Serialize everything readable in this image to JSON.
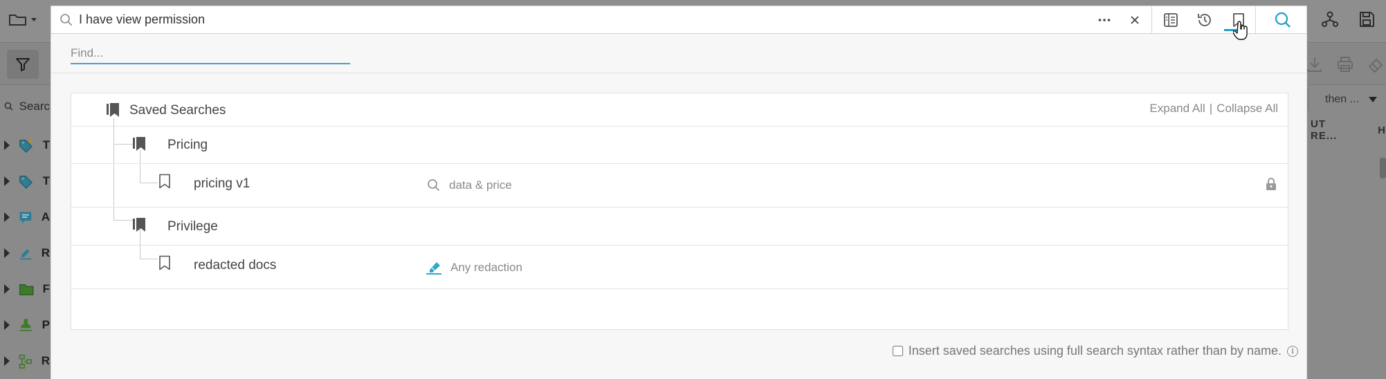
{
  "search": {
    "query": "I have view permission",
    "more_label": "···",
    "clear_label": "×"
  },
  "find": {
    "placeholder": "Find..."
  },
  "saved_searches": {
    "root_label": "Saved Searches",
    "expand_all": "Expand All",
    "separator": "|",
    "collapse_all": "Collapse All",
    "groups": [
      {
        "label": "Pricing",
        "items": [
          {
            "label": "pricing v1",
            "query": "data & price",
            "query_icon": "search-icon",
            "locked": true
          }
        ]
      },
      {
        "label": "Privilege",
        "items": [
          {
            "label": "redacted docs",
            "query": "Any redaction",
            "query_icon": "highlighter-icon",
            "locked": false
          }
        ]
      }
    ]
  },
  "insert_option": {
    "label": "Insert saved searches using full search syntax rather than by name.",
    "checked": false
  },
  "background": {
    "search_placeholder": "Searc",
    "sort_label": "then ...",
    "column_header_1": "UT RE...",
    "column_header_2": "H",
    "rows": [
      {
        "letter": "T",
        "icon": "tag-sparkle-icon"
      },
      {
        "letter": "T",
        "icon": "tag-icon"
      },
      {
        "letter": "A",
        "icon": "annotation-icon"
      },
      {
        "letter": "R",
        "icon": "redaction-icon"
      },
      {
        "letter": "F",
        "icon": "folder-icon"
      },
      {
        "letter": "P",
        "icon": "stamp-icon"
      },
      {
        "letter": "R",
        "icon": "workflow-icon"
      }
    ]
  },
  "colors": {
    "accent": "#1e9ecb",
    "panel_bg": "#f7f7f7",
    "overlay_bg": "#8a8a8a"
  }
}
